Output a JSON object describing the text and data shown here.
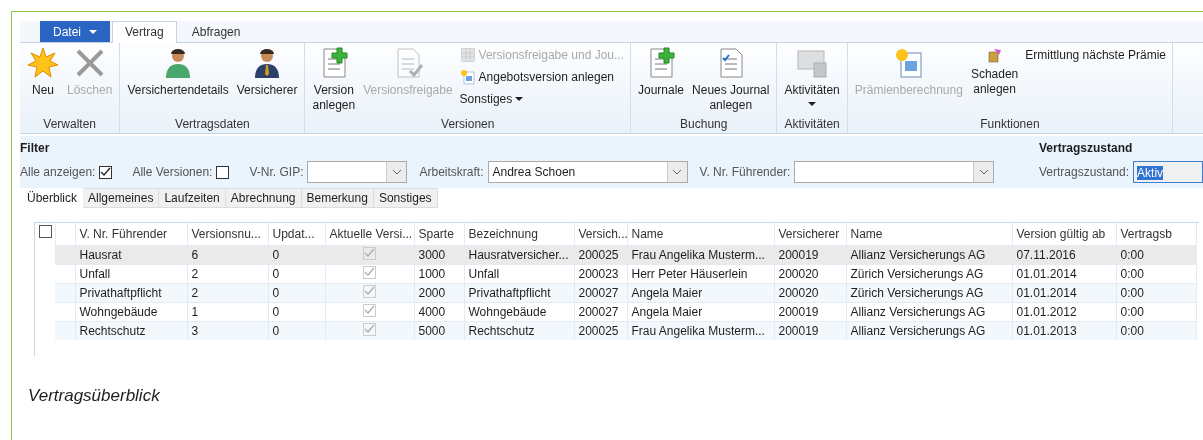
{
  "menu_tabs": [
    {
      "label": "Datei",
      "kind": "file",
      "dropdown": true
    },
    {
      "label": "Vertrag",
      "kind": "tab",
      "selected": true
    },
    {
      "label": "Abfragen",
      "kind": "tab",
      "selected": false
    }
  ],
  "ribbon_groups": [
    {
      "label": "Verwalten",
      "items": [
        {
          "label": "Neu",
          "kind": "large",
          "disabled": false
        },
        {
          "label": "Löschen",
          "kind": "large",
          "disabled": true
        }
      ]
    },
    {
      "label": "Vertragsdaten",
      "items": [
        {
          "label": "Versichertendetails",
          "kind": "large",
          "disabled": false
        },
        {
          "label": "Versicherer",
          "kind": "large",
          "disabled": false
        }
      ]
    },
    {
      "label": "Versionen",
      "items": [
        {
          "label": "Version\nanlegen",
          "kind": "large",
          "disabled": false
        },
        {
          "label": "Versionsfreigabe",
          "kind": "large",
          "disabled": true
        },
        {
          "label": "Versionsfreigabe und Jou...",
          "kind": "small",
          "disabled": true
        },
        {
          "label": "Angebotsversion anlegen",
          "kind": "small",
          "disabled": false
        },
        {
          "label": "Sonstiges",
          "kind": "small",
          "disabled": false,
          "dropdown": true
        }
      ]
    },
    {
      "label": "Buchung",
      "items": [
        {
          "label": "Journale",
          "kind": "large",
          "disabled": false
        },
        {
          "label": "Neues Journal\nanlegen",
          "kind": "large",
          "disabled": false
        }
      ]
    },
    {
      "label": "Aktivitäten",
      "items": [
        {
          "label": "Aktivitäten",
          "kind": "large",
          "disabled": false,
          "dropdown": true
        }
      ]
    },
    {
      "label": "Funktionen",
      "items": [
        {
          "label": "Prämienberechnung",
          "kind": "large",
          "disabled": true
        },
        {
          "label": "Schaden\nanlegen",
          "kind": "large",
          "disabled": false
        },
        {
          "label": "Ermittlung nächste Prämie",
          "kind": "small",
          "disabled": false
        }
      ]
    }
  ],
  "filter": {
    "title": "Filter",
    "fields": [
      {
        "label": "Alle anzeigen:",
        "kind": "checkbox",
        "checked": true
      },
      {
        "label": "Alle Versionen:",
        "kind": "checkbox",
        "checked": false
      },
      {
        "label": "V-Nr. GIP:",
        "kind": "combo"
      },
      {
        "label": "Arbeitskraft:",
        "kind": "combo",
        "value": "Andrea Schoen"
      },
      {
        "label": "V. Nr. Führender:",
        "kind": "combo"
      }
    ]
  },
  "state_filter": {
    "title": "Vertragszustand",
    "label": "Vertragszustand:",
    "value": "Aktiv",
    "value_selected": true
  },
  "sub_tabs": [
    {
      "label": "Überblick",
      "selected": true
    },
    {
      "label": "Allgemeines",
      "selected": false
    },
    {
      "label": "Laufzeiten",
      "selected": false
    },
    {
      "label": "Abrechnung",
      "selected": false
    },
    {
      "label": "Bemerkung",
      "selected": false
    },
    {
      "label": "Sonstiges",
      "selected": false
    }
  ],
  "table": {
    "select_all": false,
    "columns": [
      {
        "label": "V. Nr. Führender",
        "kind": "text"
      },
      {
        "label": "Versionsnu...",
        "kind": "text"
      },
      {
        "label": "Updat...",
        "kind": "text"
      },
      {
        "label": "Aktuelle Versi...",
        "kind": "checkbox"
      },
      {
        "label": "Sparte",
        "kind": "text"
      },
      {
        "label": "Bezeichnung",
        "kind": "text"
      },
      {
        "label": "Versich...",
        "kind": "text"
      },
      {
        "label": "Name",
        "kind": "text"
      },
      {
        "label": "Versicherer",
        "kind": "text"
      },
      {
        "label": "Name",
        "kind": "text"
      },
      {
        "label": "Version gültig ab",
        "kind": "text"
      },
      {
        "label": "Vertragsb",
        "kind": "text"
      }
    ],
    "rows": [
      {
        "selected": true,
        "cells": [
          "Hausrat",
          "6",
          "0",
          true,
          "3000",
          "Hausratversicher...",
          "200025",
          "Frau Angelika Musterm...",
          "200019",
          "Allianz Versicherungs AG",
          "07.11.2016",
          "0:00"
        ]
      },
      {
        "selected": false,
        "cells": [
          "Unfall",
          "2",
          "0",
          true,
          "1000",
          "Unfall",
          "200023",
          "Herr Peter Häuserlein",
          "200020",
          "Zürich Versicherungs AG",
          "01.01.2014",
          "0:00"
        ]
      },
      {
        "selected": false,
        "cells": [
          "Privathaftpflicht",
          "2",
          "0",
          true,
          "2000",
          "Privathaftpflicht",
          "200027",
          "Angela Maier",
          "200020",
          "Zürich Versicherungs AG",
          "01.01.2014",
          "0:00"
        ]
      },
      {
        "selected": false,
        "cells": [
          "Wohngebäude",
          "1",
          "0",
          true,
          "4000",
          "Wohngebäude",
          "200027",
          "Angela Maier",
          "200019",
          "Allianz Versicherungs AG",
          "01.01.2012",
          "0:00"
        ]
      },
      {
        "selected": false,
        "cells": [
          "Rechtschutz",
          "3",
          "0",
          true,
          "5000",
          "Rechtschutz",
          "200025",
          "Frau Angelika Musterm...",
          "200019",
          "Allianz Versicherungs AG",
          "01.01.2013",
          "0:00"
        ]
      }
    ]
  },
  "caption": "Vertragsüberblick"
}
